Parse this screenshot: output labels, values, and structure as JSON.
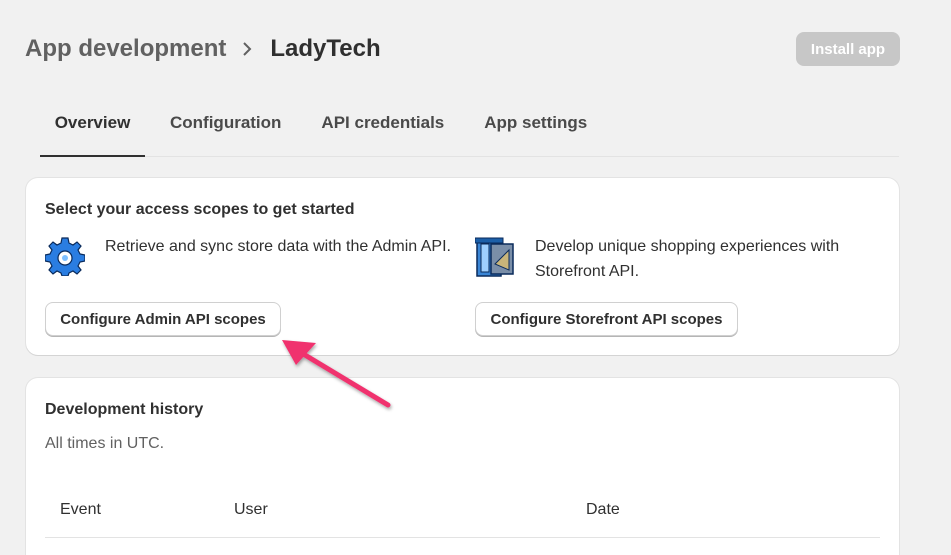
{
  "header": {
    "breadcrumb_parent": "App development",
    "breadcrumb_current": "LadyTech",
    "install_label": "Install app"
  },
  "tabs": [
    {
      "label": "Overview",
      "active": true
    },
    {
      "label": "Configuration",
      "active": false
    },
    {
      "label": "API credentials",
      "active": false
    },
    {
      "label": "App settings",
      "active": false
    }
  ],
  "scopes_card": {
    "title": "Select your access scopes to get started",
    "admin_text": "Retrieve and sync store data with the Admin API.",
    "storefront_text": "Develop unique shopping experiences with Storefront API.",
    "admin_button": "Configure Admin API scopes",
    "storefront_button": "Configure Storefront API scopes",
    "admin_icon": "gear-icon",
    "storefront_icon": "storefront-icon"
  },
  "history_card": {
    "title": "Development history",
    "subtitle": "All times in UTC.",
    "columns": [
      "Event",
      "User",
      "Date"
    ]
  },
  "colors": {
    "background": "#f1f1f1",
    "card": "#ffffff",
    "disabled_button": "#c7c7c7",
    "annotation_arrow": "#f0306e"
  }
}
